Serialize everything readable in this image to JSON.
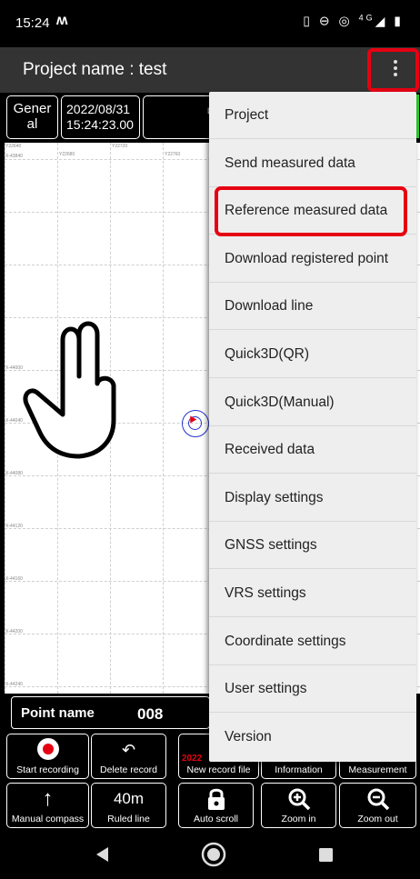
{
  "status_bar": {
    "time": "15:24",
    "notification_glyph": "ʍ",
    "icons": [
      "vibrate-icon",
      "do-not-disturb-icon",
      "hotspot-icon",
      "signal-4g-icon",
      "battery-icon"
    ],
    "network_label": "4G"
  },
  "app_bar": {
    "title": "Project name : test",
    "overflow_icon": "more-vert-icon"
  },
  "info_strip": {
    "mode": "Gener al",
    "date": "2022/08/31",
    "time": "15:24:23.00",
    "lat_partial": "L",
    "lat_partial2": "I"
  },
  "map": {
    "top_coords": [
      "Y22640",
      "Y22680",
      "Y22720",
      "Y22760"
    ],
    "left_coords": [
      "X-43840",
      "X-44000",
      "X-44040",
      "X-44080",
      "X-44120",
      "X-44160",
      "X-44200",
      "X-44240"
    ]
  },
  "point": {
    "label": "Point name",
    "value": "008"
  },
  "toolbar_row1": [
    {
      "label": "Start recording",
      "icon": "record-icon"
    },
    {
      "label": "Delete record",
      "icon": "undo-icon"
    },
    {
      "label": "New record file",
      "icon": "new-file-icon",
      "overlay_text": "2022"
    },
    {
      "label": "Information",
      "icon": "info-icon"
    },
    {
      "label": "Measurement",
      "icon": "measurement-icon"
    }
  ],
  "toolbar_row2": [
    {
      "label": "Manual compass",
      "icon": "arrow-up-icon"
    },
    {
      "label": "Ruled line",
      "icon_text": "40m"
    },
    {
      "label": "Auto scroll",
      "icon": "lock-icon"
    },
    {
      "label": "Zoom in",
      "icon": "zoom-in-icon"
    },
    {
      "label": "Zoom out",
      "icon": "zoom-out-icon"
    }
  ],
  "menu": {
    "items": [
      "Project",
      "Send measured data",
      "Reference measured data",
      "Download registered point",
      "Download line",
      "Quick3D(QR)",
      "Quick3D(Manual)",
      "Received data",
      "Display settings",
      "GNSS settings",
      "VRS settings",
      "Coordinate settings",
      "User settings",
      "Version"
    ],
    "highlighted_item": "Reference measured data"
  },
  "colors": {
    "highlight": "#e60012",
    "app_bar": "#333333",
    "menu_bg": "#eeeeee",
    "status_ok": "#2ad12a",
    "marker": "#2233cc"
  },
  "nav_bar": {
    "icons": [
      "back-icon",
      "home-icon",
      "recents-icon"
    ]
  }
}
